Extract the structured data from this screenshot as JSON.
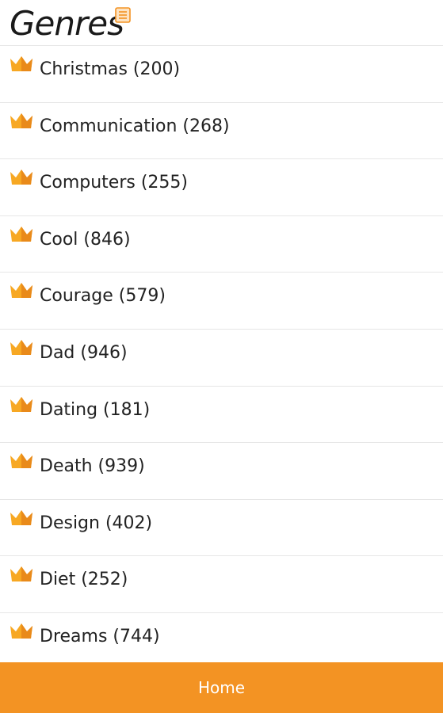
{
  "header": {
    "title": "Genres",
    "menu_icon": "list-menu-icon"
  },
  "colors": {
    "accent": "#f39323",
    "crown_light": "#f7a823",
    "crown_dark": "#e98a1a"
  },
  "genres": [
    {
      "label": "Christmas (200)",
      "icon": "crown-icon"
    },
    {
      "label": "Communication (268)",
      "icon": "crown-icon"
    },
    {
      "label": "Computers (255)",
      "icon": "crown-icon"
    },
    {
      "label": "Cool (846)",
      "icon": "crown-icon"
    },
    {
      "label": "Courage (579)",
      "icon": "crown-icon"
    },
    {
      "label": "Dad (946)",
      "icon": "crown-icon"
    },
    {
      "label": "Dating (181)",
      "icon": "crown-icon"
    },
    {
      "label": "Death (939)",
      "icon": "crown-icon"
    },
    {
      "label": "Design (402)",
      "icon": "crown-icon"
    },
    {
      "label": "Diet (252)",
      "icon": "crown-icon"
    },
    {
      "label": "Dreams (744)",
      "icon": "crown-icon"
    }
  ],
  "footer": {
    "home_label": "Home"
  }
}
